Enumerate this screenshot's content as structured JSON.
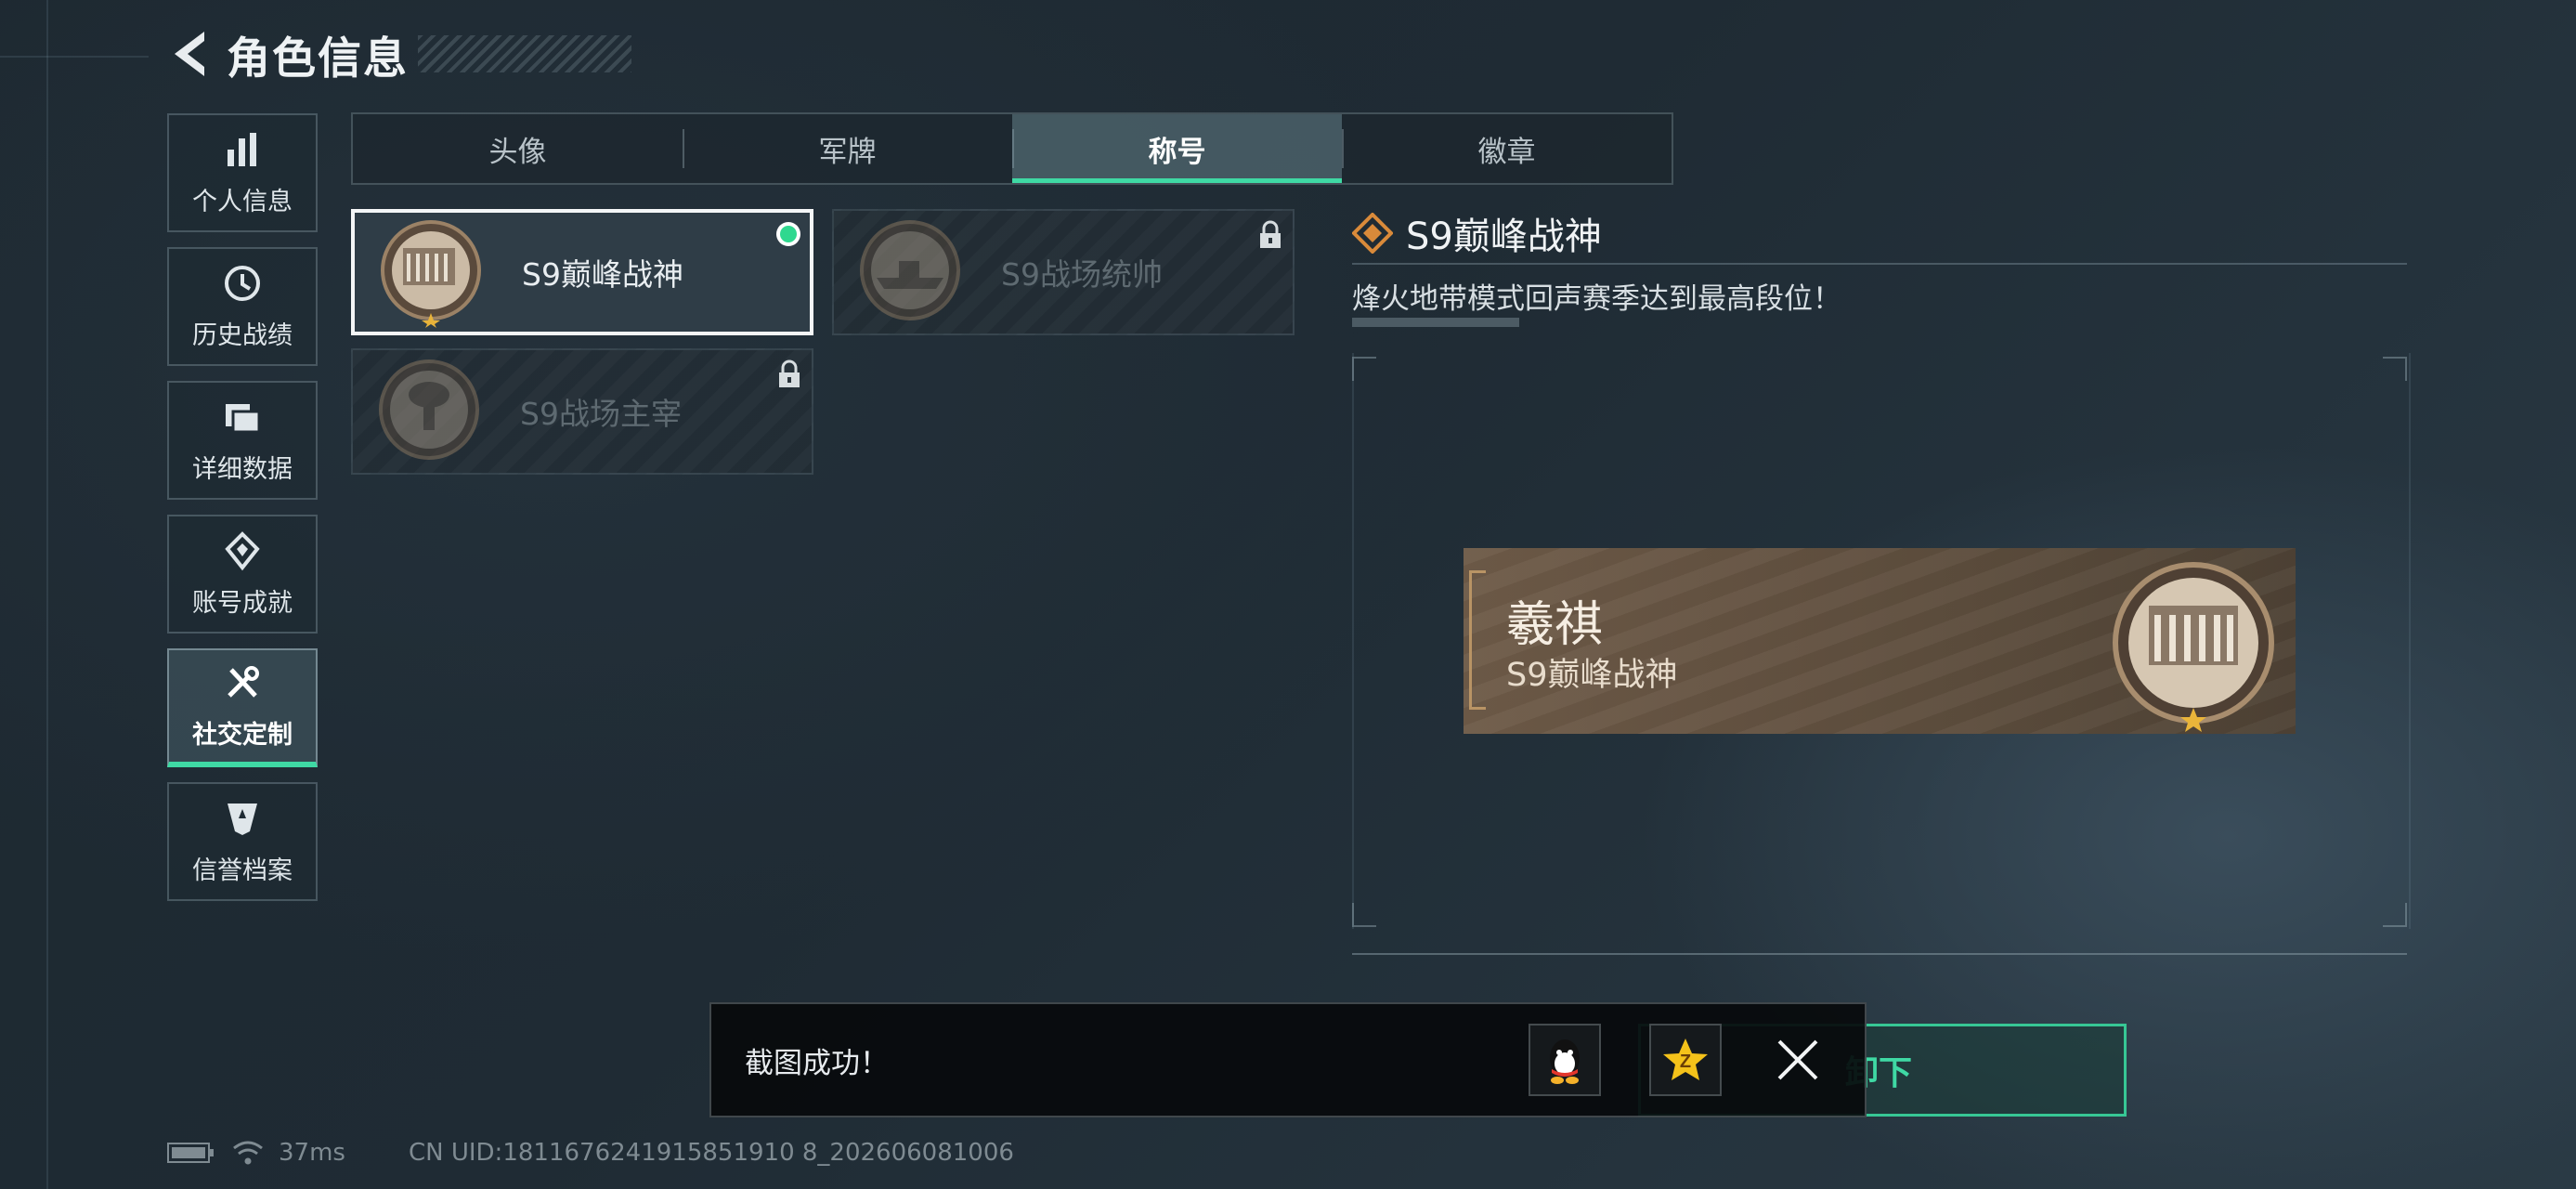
{
  "header": {
    "title": "角色信息"
  },
  "sidebar": {
    "items": [
      {
        "label": "个人信息",
        "icon": "bar-chart-icon",
        "active": false
      },
      {
        "label": "历史战绩",
        "icon": "clock-icon",
        "active": false
      },
      {
        "label": "详细数据",
        "icon": "folder-icon",
        "active": false
      },
      {
        "label": "账号成就",
        "icon": "achievement-icon",
        "active": false
      },
      {
        "label": "社交定制",
        "icon": "tools-icon",
        "active": true
      },
      {
        "label": "信誉档案",
        "icon": "credit-icon",
        "active": false
      }
    ]
  },
  "tabs": [
    {
      "label": "头像",
      "active": false
    },
    {
      "label": "军牌",
      "active": false
    },
    {
      "label": "称号",
      "active": true
    },
    {
      "label": "徽章",
      "active": false
    }
  ],
  "titles": [
    {
      "name": "S9巅峰战神",
      "state": "equipped",
      "emblem": "building-emblem-icon"
    },
    {
      "name": "S9战场统帅",
      "state": "locked",
      "emblem": "warship-emblem-icon"
    },
    {
      "name": "S9战场主宰",
      "state": "locked",
      "emblem": "mushroom-cloud-emblem-icon"
    }
  ],
  "detail": {
    "title": "S9巅峰战神",
    "description": "烽火地带模式回声赛季达到最高段位！"
  },
  "nameplate": {
    "player_name": "羲祺",
    "title": "S9巅峰战神"
  },
  "unequip_button": {
    "label": "卸下"
  },
  "toast": {
    "message": "截图成功！",
    "share_targets": [
      "qq-icon",
      "qzone-icon"
    ]
  },
  "status": {
    "ping": "37ms",
    "uid": "CN UID:1811676241915851910 8_202606081006"
  },
  "colors": {
    "accent": "#3fd9a4",
    "plate_bg": "#6e5b48",
    "title_icon": "#d98a3a"
  }
}
